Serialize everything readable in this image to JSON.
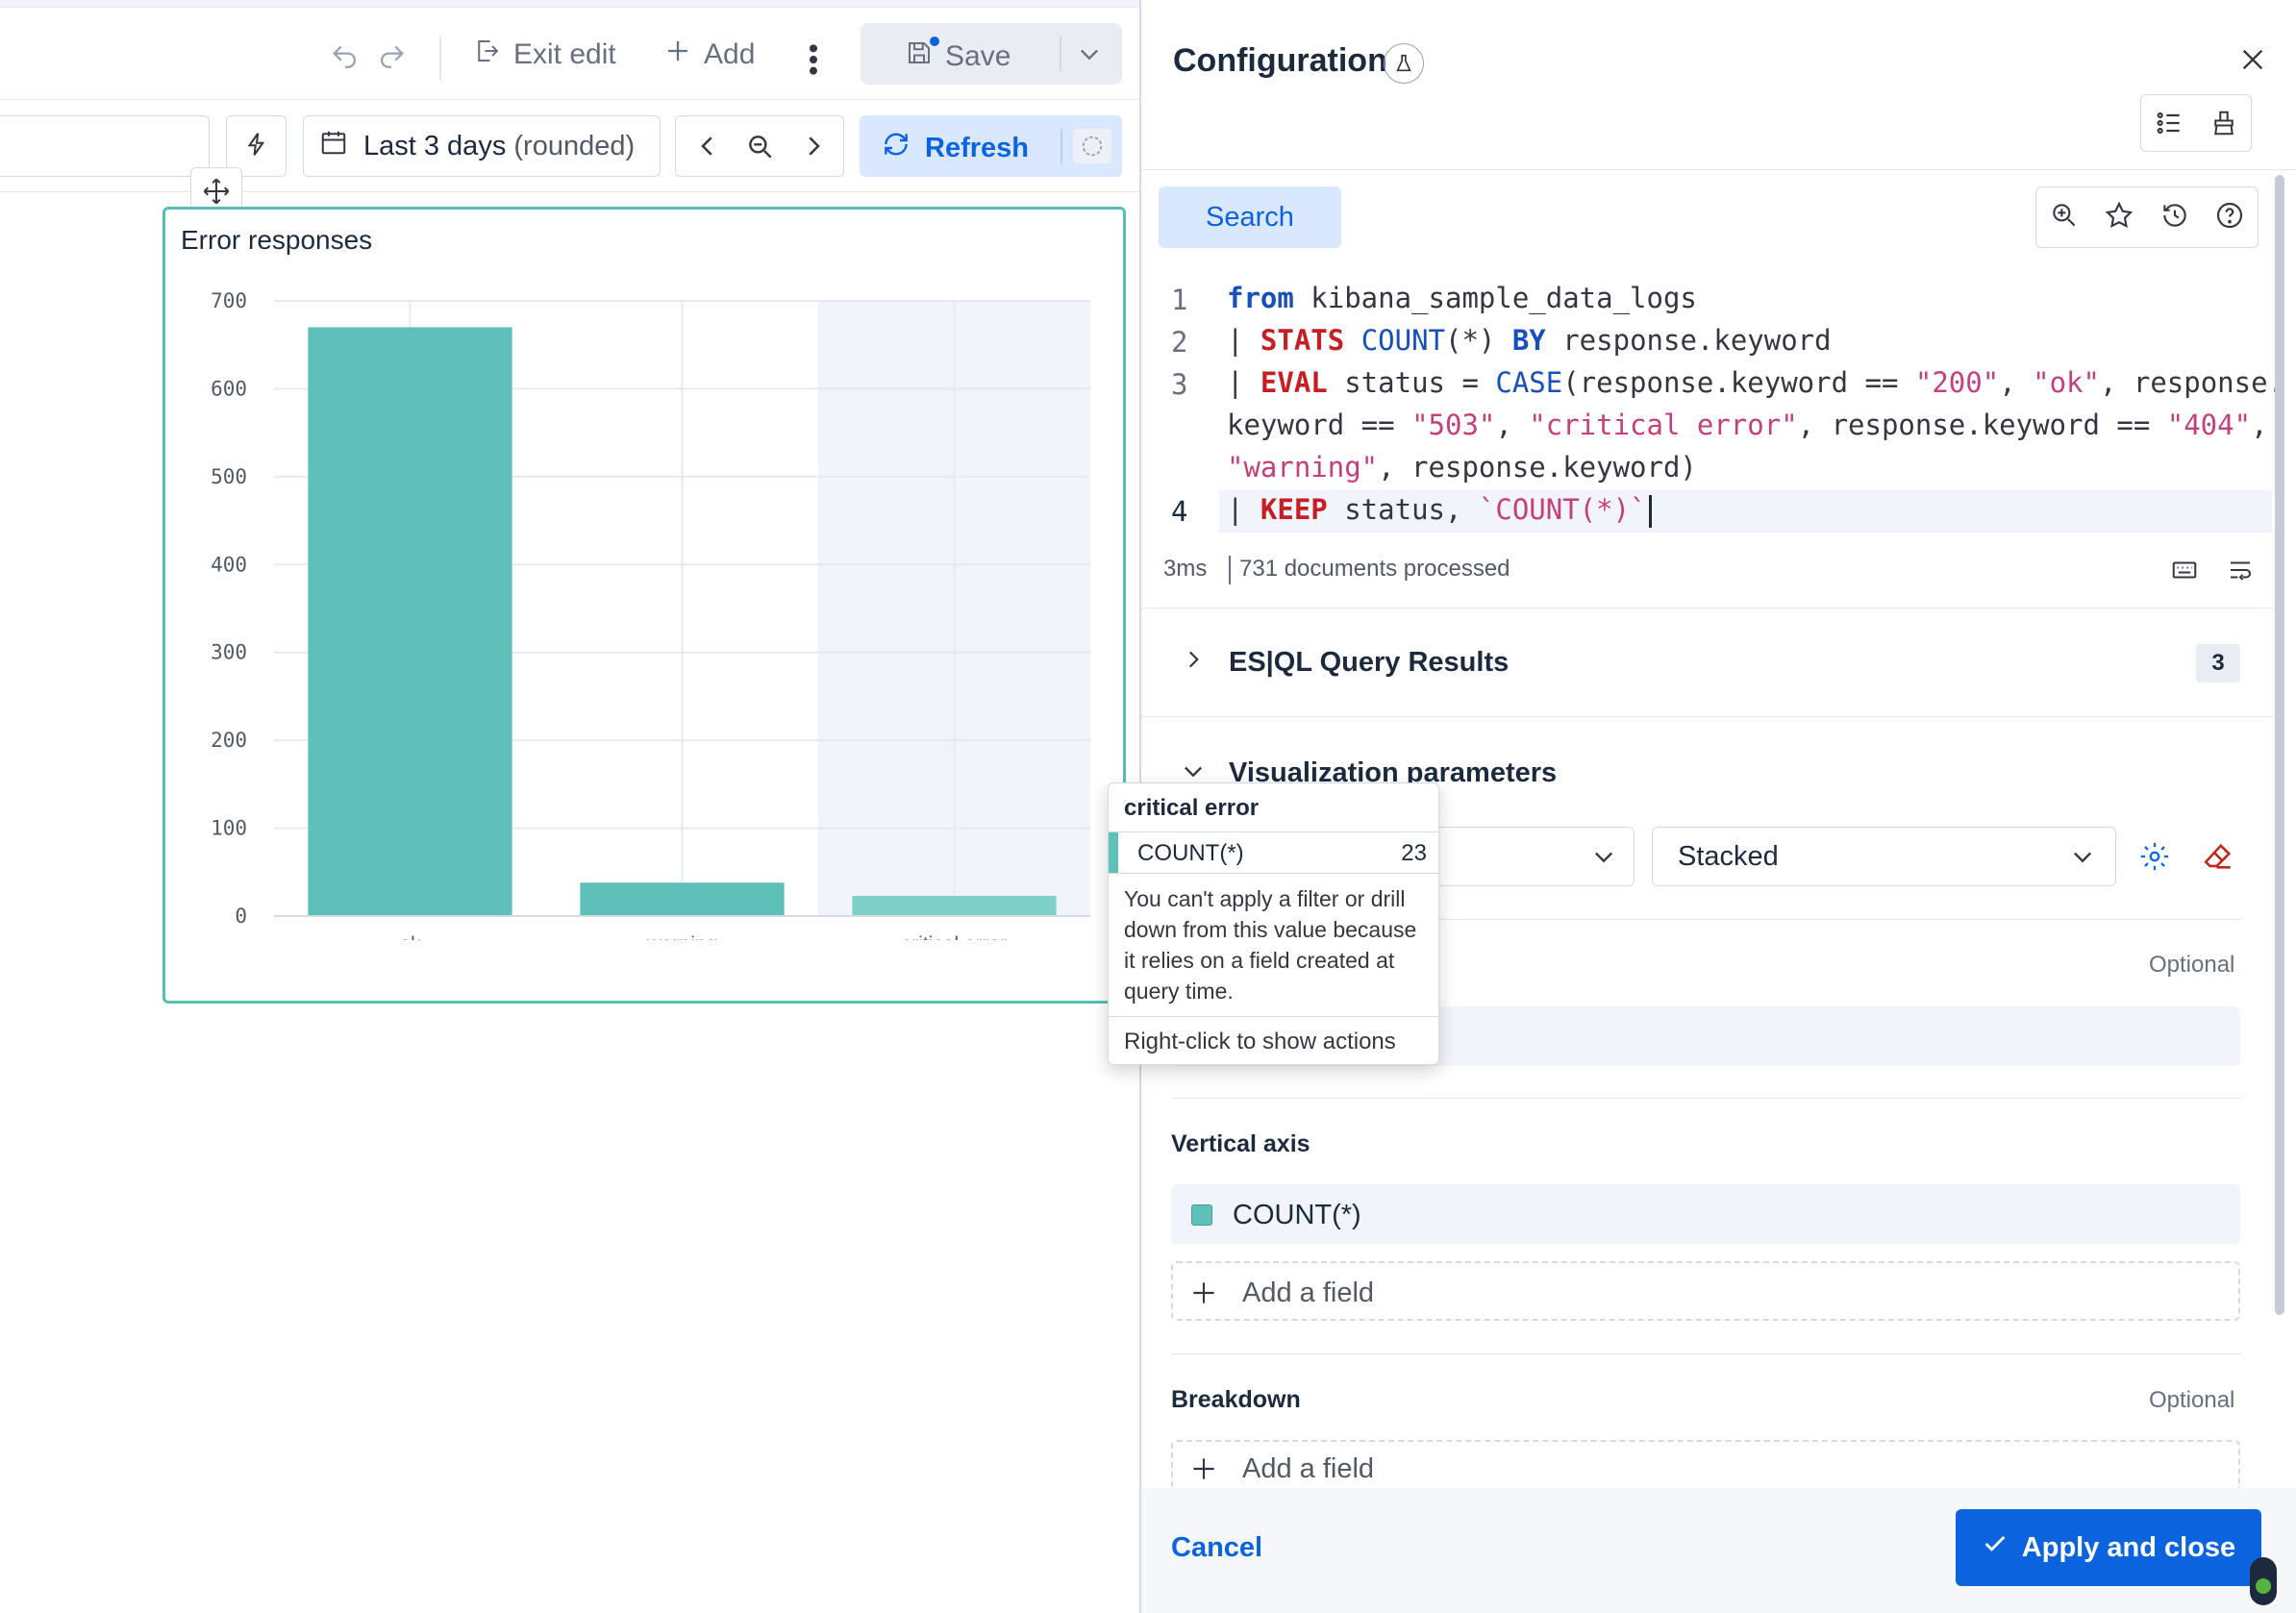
{
  "toolbar": {
    "exit_edit": "Exit edit",
    "add": "Add",
    "save": "Save"
  },
  "querybar": {
    "date_range": "Last 3 days",
    "date_suffix": "(rounded)",
    "refresh": "Refresh"
  },
  "panel": {
    "title": "Error responses"
  },
  "chart_data": {
    "type": "bar",
    "title": "Error responses",
    "categories": [
      "ok",
      "warning",
      "critical error"
    ],
    "series": [
      {
        "name": "COUNT(*)",
        "values": [
          670,
          38,
          23
        ],
        "color": "#5fc0b9"
      }
    ],
    "ylim": [
      0,
      700
    ],
    "yticks": [
      "0",
      "100",
      "200",
      "300",
      "400",
      "500",
      "600",
      "700"
    ],
    "grid": true,
    "highlighted_category": "critical error"
  },
  "tooltip": {
    "title": "critical error",
    "series_name": "COUNT(*)",
    "value": "23",
    "message": "You can't apply a filter or drill down from this value because it relies on a field created at query time.",
    "footer": "Right-click to show actions"
  },
  "flyout": {
    "title": "Configuration",
    "search_tab": "Search",
    "query_lines": {
      "l1_num": "1",
      "l2_num": "2",
      "l3_num": "3",
      "l4_num": "4",
      "l1_kw": "from",
      "l1_rest": " kibana_sample_data_logs",
      "l2_pipe": "| ",
      "l2_kw": "STATS",
      "l2_fn": " COUNT",
      "l2_a": "(*) ",
      "l2_by": "BY",
      "l2_rest": " response.keyword",
      "l3_pipe": "| ",
      "l3_kw": "EVAL",
      "l3_a": " status = ",
      "l3_fn": "CASE",
      "l3_b": "(response.keyword == ",
      "l3_s1": "\"200\"",
      "l3_c": ", ",
      "l3_s2": "\"ok\"",
      "l3_d": ", response.",
      "l3b_a": "keyword == ",
      "l3b_s1": "\"503\"",
      "l3b_b": ", ",
      "l3b_s2": "\"critical error\"",
      "l3b_c": ", response.keyword == ",
      "l3b_s3": "\"404\"",
      "l3b_d": ",",
      "l3c_s1": "\"warning\"",
      "l3c_a": ", response.keyword)",
      "l4_pipe": "| ",
      "l4_kw": "KEEP",
      "l4_a": " status, ",
      "l4_s": "`COUNT(*)`"
    },
    "timing": "3ms",
    "docs": "731 documents processed",
    "results_label": "ES|QL Query Results",
    "results_count": "3",
    "viz_params_label": "Visualization parameters",
    "mode_select": "Stacked",
    "optional_1": "Optional",
    "vertical_axis_label": "Vertical axis",
    "vertical_axis_field": "COUNT(*)",
    "add_field_1": "Add a field",
    "breakdown_label": "Breakdown",
    "optional_2": "Optional",
    "add_field_2": "Add a field",
    "cancel": "Cancel",
    "apply": "Apply and close"
  },
  "colors": {
    "accent": "#0b64dd",
    "series": "#5fc0b9",
    "panel_border": "#55bfb6"
  }
}
